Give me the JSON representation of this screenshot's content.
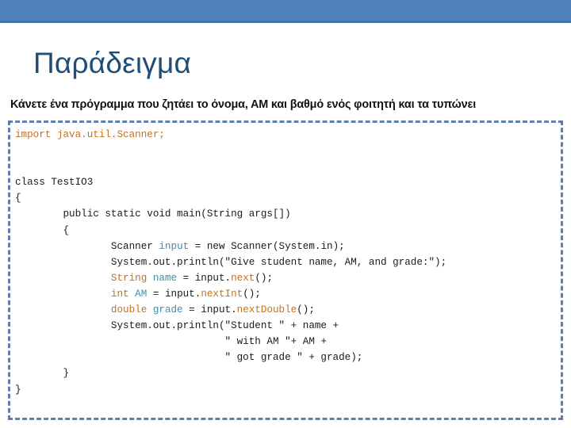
{
  "slide": {
    "title": "Παράδειγμα",
    "task_statement": "Κάνετε ένα πρόγραμμα που ζητάει το όνομα, ΑΜ και βαθμό ενός φοιτητή και τα τυπώνει",
    "banner_color": "#4F81BD",
    "title_color": "#1F4E79",
    "code_border_color": "#5E80AB"
  },
  "code": {
    "language": "java",
    "colors": {
      "keyword": "#C5701A",
      "variable": "#3D8DA8",
      "method": "#C5701A",
      "plain": "#1A1A1A"
    },
    "lines": [
      {
        "segments": [
          {
            "t": "import java.util.Scanner;",
            "c": "tok-imp"
          }
        ]
      },
      {
        "segments": [
          {
            "t": "",
            "c": "tok-txt"
          }
        ]
      },
      {
        "segments": [
          {
            "t": "",
            "c": "tok-txt"
          }
        ]
      },
      {
        "segments": [
          {
            "t": "class TestIO3",
            "c": "tok-txt"
          }
        ]
      },
      {
        "segments": [
          {
            "t": "{",
            "c": "tok-txt"
          }
        ]
      },
      {
        "segments": [
          {
            "t": "        public static void main(String args[])",
            "c": "tok-txt"
          }
        ]
      },
      {
        "segments": [
          {
            "t": "        {",
            "c": "tok-txt"
          }
        ]
      },
      {
        "segments": [
          {
            "t": "                Scanner ",
            "c": "tok-txt"
          },
          {
            "t": "input",
            "c": "tok-var"
          },
          {
            "t": " = new Scanner(System.in);",
            "c": "tok-txt"
          }
        ]
      },
      {
        "segments": [
          {
            "t": "                System.out.println(\"Give student name, AM, and grade:\");",
            "c": "tok-txt"
          }
        ]
      },
      {
        "segments": [
          {
            "t": "                String",
            "c": "tok-kw"
          },
          {
            "t": " ",
            "c": "tok-txt"
          },
          {
            "t": "name",
            "c": "tok-var"
          },
          {
            "t": " = input.",
            "c": "tok-txt"
          },
          {
            "t": "next",
            "c": "tok-mth"
          },
          {
            "t": "();",
            "c": "tok-txt"
          }
        ]
      },
      {
        "segments": [
          {
            "t": "                int",
            "c": "tok-kw"
          },
          {
            "t": " ",
            "c": "tok-txt"
          },
          {
            "t": "AM",
            "c": "tok-var"
          },
          {
            "t": " = input.",
            "c": "tok-txt"
          },
          {
            "t": "nextInt",
            "c": "tok-mth"
          },
          {
            "t": "();",
            "c": "tok-txt"
          }
        ]
      },
      {
        "segments": [
          {
            "t": "                double",
            "c": "tok-kw"
          },
          {
            "t": " ",
            "c": "tok-txt"
          },
          {
            "t": "grade",
            "c": "tok-var"
          },
          {
            "t": " = input.",
            "c": "tok-txt"
          },
          {
            "t": "nextDouble",
            "c": "tok-mth"
          },
          {
            "t": "();",
            "c": "tok-txt"
          }
        ]
      },
      {
        "segments": [
          {
            "t": "                System.out.println(\"Student \" + name +",
            "c": "tok-txt"
          }
        ]
      },
      {
        "segments": [
          {
            "t": "                                   \" with AM \"+ AM +",
            "c": "tok-txt"
          }
        ]
      },
      {
        "segments": [
          {
            "t": "                                   \" got grade \" + grade);",
            "c": "tok-txt"
          }
        ]
      },
      {
        "segments": [
          {
            "t": "        }",
            "c": "tok-txt"
          }
        ]
      },
      {
        "segments": [
          {
            "t": "}",
            "c": "tok-txt"
          }
        ]
      }
    ]
  }
}
